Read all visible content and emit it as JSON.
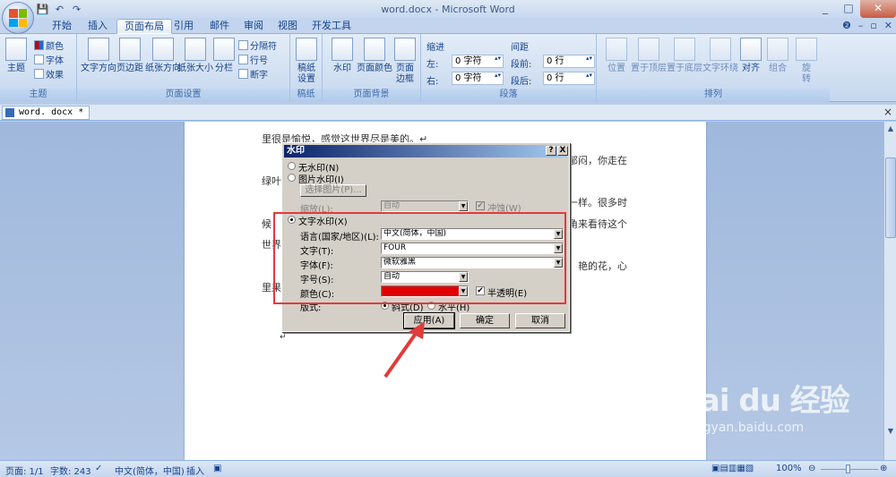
{
  "app": {
    "title": "word.docx - Microsoft Word",
    "minimize": "_",
    "maximize": "□",
    "close": "✕"
  },
  "qat": {
    "save": "💾",
    "undo": "↶",
    "redo": "↷"
  },
  "tabs": [
    "开始",
    "插入",
    "页面布局",
    "引用",
    "邮件",
    "审阅",
    "视图",
    "开发工具"
  ],
  "ribbon": {
    "themes": {
      "group": "主题",
      "theme": "主题",
      "colors": "颜色",
      "fonts": "字体",
      "effects": "效果"
    },
    "page_setup": {
      "group": "页面设置",
      "text_direction": "文字方向",
      "margins": "页边距",
      "orientation": "纸张方向",
      "size": "纸张大小",
      "columns": "分栏",
      "breaks": "分隔符",
      "line_numbers": "行号",
      "hyphenation": "断字"
    },
    "draft": {
      "group": "稿纸",
      "settings": "稿纸\n设置"
    },
    "page_background": {
      "group": "页面背景",
      "watermark": "水印",
      "page_color": "页面颜色",
      "page_borders": "页面\n边框"
    },
    "paragraph": {
      "group": "段落",
      "indent": "缩进",
      "spacing": "间距",
      "left_label": "左:",
      "left_value": "0 字符",
      "right_label": "右:",
      "right_value": "0 字符",
      "before_label": "段前:",
      "before_value": "0 行",
      "after_label": "段后:",
      "after_value": "0 行"
    },
    "arrange": {
      "group": "排列",
      "position": "位置",
      "bring_front": "置于顶层",
      "send_back": "置于底层",
      "text_wrap": "文字环绕",
      "align": "对齐",
      "group_btn": "组合",
      "rotate": "旋\n转"
    }
  },
  "doc_tab": {
    "name": "word. docx *",
    "close": "×"
  },
  "document": {
    "lines": [
      "里很是愉悦，感觉这世界尽是美的。↵",
      "郁闷，你走在",
      "绿叶",
      "一样。很多时",
      "候",
      "角来看待这个",
      "世界",
      "，艳的花，心",
      "里果",
      "↵"
    ]
  },
  "dialog": {
    "title": "水印",
    "help": "?",
    "close": "X",
    "no_watermark": "无水印(N)",
    "picture_watermark": "图片水印(I)",
    "select_picture": "选择图片(P)...",
    "scale_label": "缩放(L):",
    "scale_value": "自动",
    "washout": "冲蚀(W)",
    "text_watermark": "文字水印(X)",
    "language_label": "语言(国家/地区)(L):",
    "language_value": "中文(简体，中国)",
    "text_label": "文字(T):",
    "text_value": "FOUR",
    "font_label": "字体(F):",
    "font_value": "微软雅黑",
    "size_label": "字号(S):",
    "size_value": "自动",
    "color_label": "颜色(C):",
    "color_value": "#e00000",
    "semitransparent": "半透明(E)",
    "layout_label": "版式:",
    "diagonal": "斜式(D)",
    "horizontal": "水平(H)",
    "apply": "应用(A)",
    "ok": "确定",
    "cancel": "取消"
  },
  "status": {
    "page": "页面: 1/1",
    "words": "字数: 243",
    "language": "中文(简体，中国)",
    "insert": "插入",
    "zoom": "100%"
  },
  "watermark": {
    "brand": "Bai du 经验",
    "url": "jingyan.baidu.com"
  },
  "colors": {
    "annotation": "#e33a3a",
    "accent": "#15428b"
  }
}
